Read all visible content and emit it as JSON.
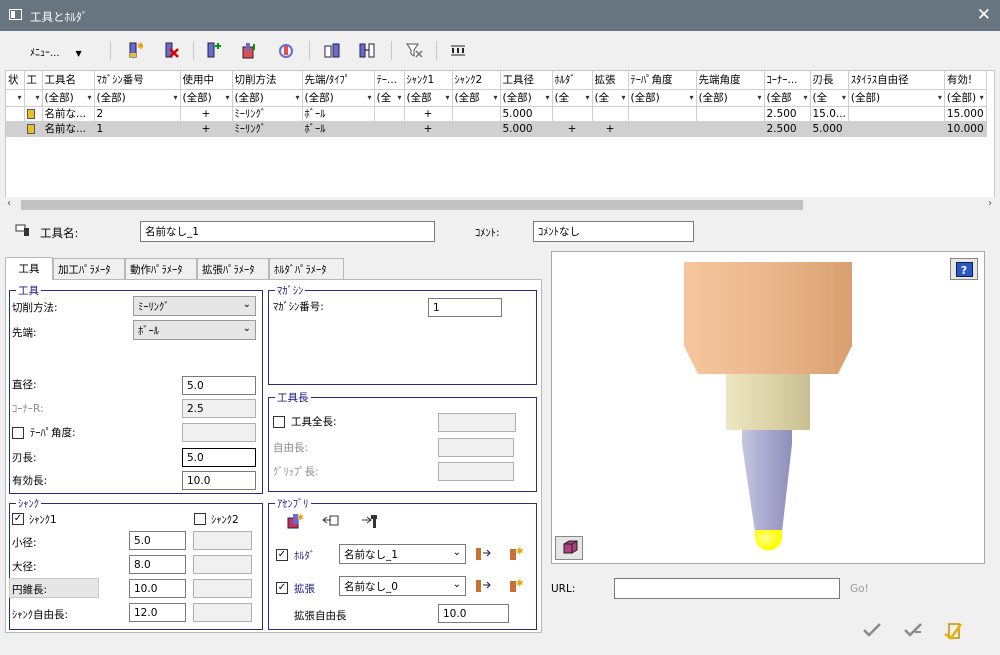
{
  "window": {
    "title": "工具とﾎﾙﾀﾞ",
    "close_label": "✕"
  },
  "toolbar": {
    "menu_label": "ﾒﾆｭｰ..."
  },
  "grid": {
    "columns": [
      "状",
      "工",
      "工具名",
      "ﾏｶﾞｼﾝ番号",
      "使用中",
      "切削方法",
      "先端/ﾀｲﾌﾟ",
      "ﾃｰ...",
      "ｼｬﾝｸ1",
      "ｼｬﾝｸ2",
      "工具径",
      "ﾎﾙﾀﾞ",
      "拡張",
      "ﾃｰﾊﾟ角度",
      "先端角度",
      "ｺｰﾅｰ...",
      "刃長",
      "ｽﾀｲﾗｽ自由径",
      "有効!"
    ],
    "filters": [
      "",
      "",
      "(全部)",
      "(全部)",
      "(全部)",
      "(全部)",
      "(全部)",
      "(全",
      "(全部",
      "(全部",
      "(全部)",
      "(全",
      "(全",
      "(全部)",
      "(全部)",
      "(全部",
      "(全",
      "(全部)",
      "(全部)"
    ],
    "rows": [
      [
        "",
        "",
        "名前な...",
        "2",
        "+",
        "ﾐｰﾘﾝｸﾞ",
        "ﾎﾞｰﾙ",
        "",
        "+",
        "",
        "5.000",
        "",
        "",
        "",
        "",
        "2.500",
        "15.0...",
        "",
        "15.000"
      ],
      [
        "",
        "",
        "名前な...",
        "1",
        "+",
        "ﾐｰﾘﾝｸﾞ",
        "ﾎﾞｰﾙ",
        "",
        "+",
        "",
        "5.000",
        "+",
        "+",
        "",
        "",
        "2.500",
        "5.000",
        "",
        "10.000"
      ]
    ]
  },
  "header_fields": {
    "tool_name_label": "工具名:",
    "tool_name_value": "名前なし_1",
    "comment_label": "ｺﾒﾝﾄ:",
    "comment_value": "ｺﾒﾝﾄなし"
  },
  "tabs": [
    "工具",
    "加工ﾊﾟﾗﾒｰﾀ",
    "動作ﾊﾟﾗﾒｰﾀ",
    "拡張ﾊﾟﾗﾒｰﾀ",
    "ﾎﾙﾀﾞﾊﾟﾗﾒｰﾀ"
  ],
  "tool_group": {
    "title": "工具",
    "cut_method_label": "切削方法:",
    "cut_method_value": "ﾐｰﾘﾝｸﾞ",
    "tip_label": "先端:",
    "tip_value": "ﾎﾞｰﾙ",
    "diameter_label": "直径:",
    "diameter_value": "5.0",
    "corner_label": "ｺｰﾅｰR:",
    "corner_value": "2.5",
    "taper_label": "ﾃｰﾊﾟ角度:",
    "taper_value": "",
    "blade_label": "刃長:",
    "blade_value": "5.0",
    "effective_label": "有効長:",
    "effective_value": "10.0"
  },
  "magazine_group": {
    "title": "ﾏｶﾞｼﾝ",
    "number_label": "ﾏｶﾞｼﾝ番号:",
    "number_value": "1"
  },
  "tool_length_group": {
    "title": "工具長",
    "total_label": "工具全長:",
    "free_label": "自由長:",
    "grip_label": "ｸﾞﾘｯﾌﾟ長:"
  },
  "shank_group": {
    "title": "ｼｬﾝｸ",
    "shank1_label": "ｼｬﾝｸ1",
    "shank1_checked": true,
    "shank2_label": "ｼｬﾝｸ2",
    "shank2_checked": false,
    "small_label": "小径:",
    "small_value": "5.0",
    "large_label": "大径:",
    "large_value": "8.0",
    "cone_label": "円錐長:",
    "cone_value": "10.0",
    "free_label": "ｼｬﾝｸ自由長:",
    "free_value": "12.0"
  },
  "assembly_group": {
    "title": "ｱｾﾝﾌﾞﾘ",
    "holder_label": "ﾎﾙﾀﾞ",
    "holder_checked": true,
    "holder_value": "名前なし_1",
    "ext_label": "拡張",
    "ext_checked": true,
    "ext_value": "名前なし_0",
    "ext_free_label": "拡張自由長",
    "ext_free_value": "10.0"
  },
  "preview": {
    "help_label": "?"
  },
  "url": {
    "label": "URL:",
    "value": "",
    "go_label": "Go!"
  },
  "colors": {
    "titlebar": "#687581",
    "group_border": "#2b2b8a",
    "holder": "#f0c8a0",
    "collar": "#e0dab8",
    "shank": "#b0b0d8",
    "ball": "#ffff00"
  }
}
